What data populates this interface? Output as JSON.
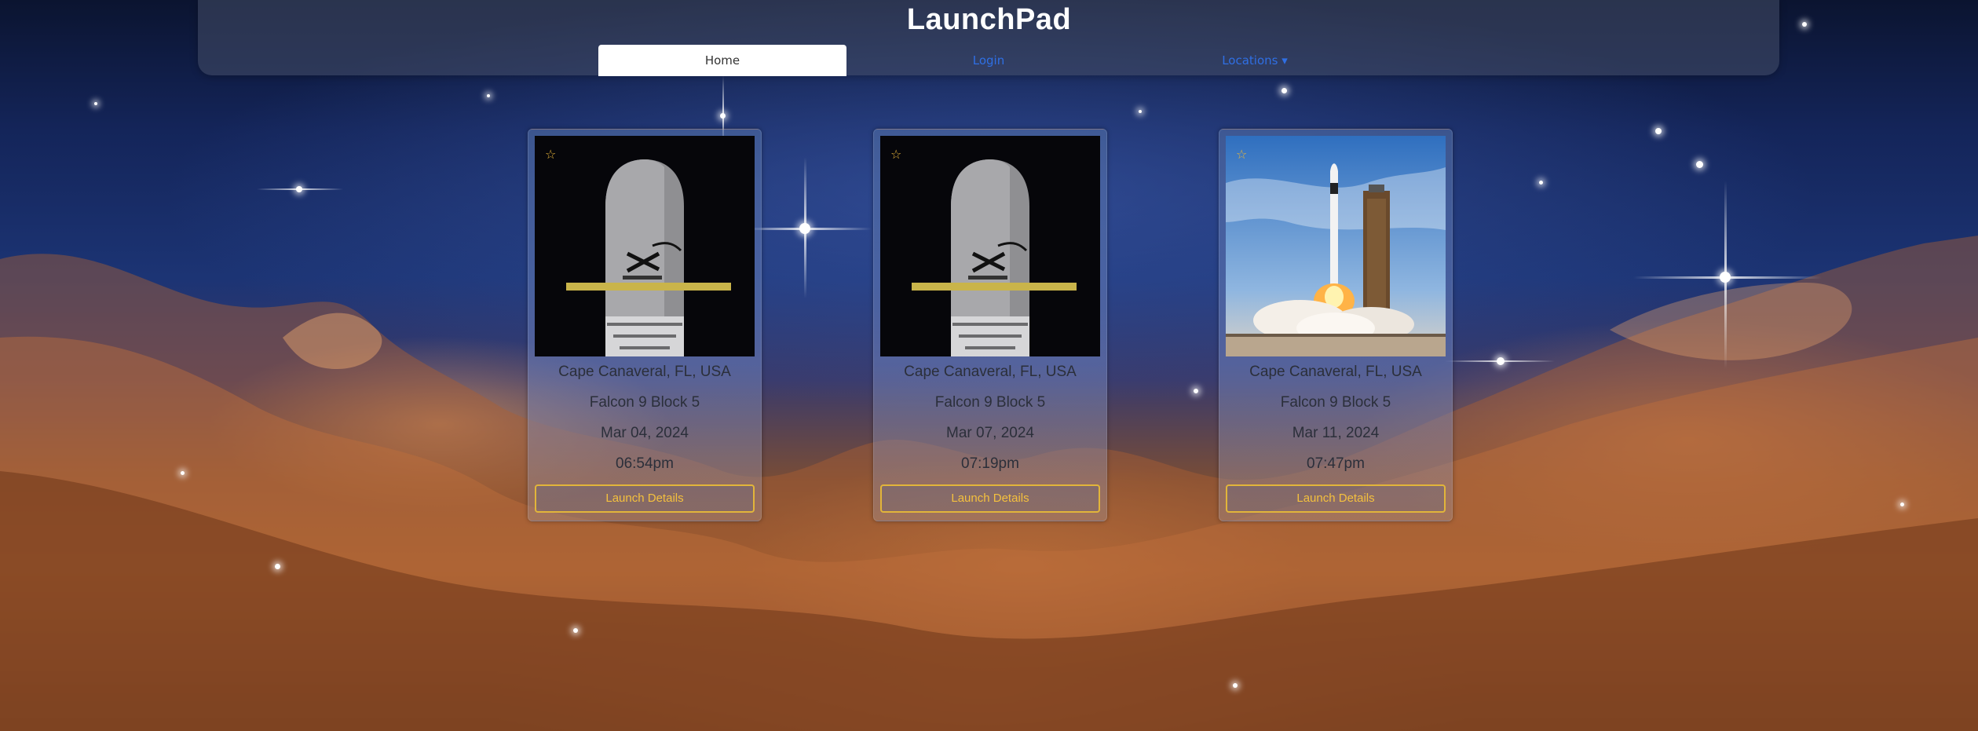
{
  "app": {
    "title": "LaunchPad"
  },
  "nav": {
    "tabs": [
      {
        "label": "Home",
        "active": true
      },
      {
        "label": "Login"
      },
      {
        "label": "Locations ▾"
      }
    ]
  },
  "cards": [
    {
      "image": "starlink-fairing",
      "location": "Cape Canaveral, FL, USA",
      "rocket": "Falcon 9 Block 5",
      "date": "Mar 04, 2024",
      "time": "06:54pm",
      "button": "Launch Details"
    },
    {
      "image": "starlink-fairing",
      "location": "Cape Canaveral, FL, USA",
      "rocket": "Falcon 9 Block 5",
      "date": "Mar 07, 2024",
      "time": "07:19pm",
      "button": "Launch Details"
    },
    {
      "image": "rocket-liftoff",
      "location": "Cape Canaveral, FL, USA",
      "rocket": "Falcon 9 Block 5",
      "date": "Mar 11, 2024",
      "time": "07:47pm",
      "button": "Launch Details"
    }
  ],
  "icons": {
    "favorite": "star-outline-icon"
  },
  "colors": {
    "accent": "#f4c03e",
    "link": "#2f6fe4",
    "header_bg": "#464e68"
  }
}
